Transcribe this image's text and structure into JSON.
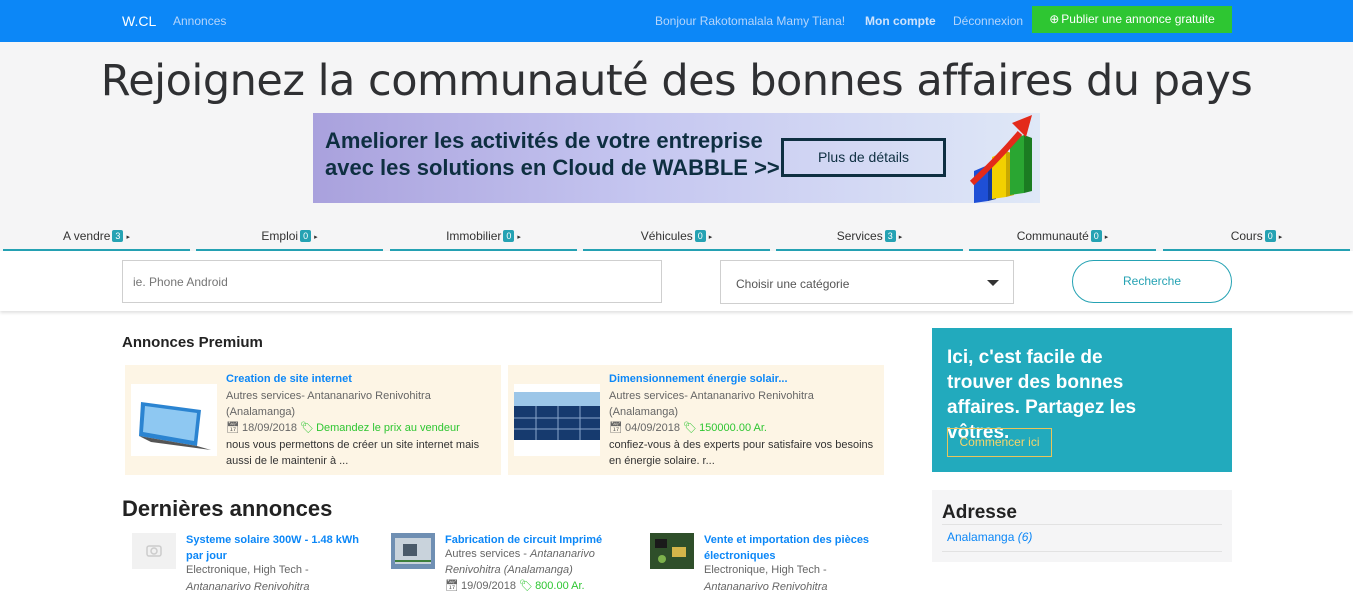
{
  "topbar": {
    "brand": "W.CL",
    "annonces": "Annonces",
    "greeting": "Bonjour Rakotomalala Mamy Tiana!",
    "account": "Mon compte",
    "logout": "Déconnexion",
    "publish": "Publier une annonce gratuite",
    "bg_color": "#0c87f7",
    "publish_color": "#2ec632"
  },
  "hero": {
    "headline": "Rejoignez la communauté des bonnes affaires du pays",
    "banner_line1": "Ameliorer les activités de votre entreprise",
    "banner_line2": "avec les solutions en Cloud de WABBLE >>",
    "banner_button": "Plus de détails"
  },
  "categories": [
    {
      "label": "A vendre",
      "count": "3"
    },
    {
      "label": "Emploi",
      "count": "0"
    },
    {
      "label": "Immobilier",
      "count": "0"
    },
    {
      "label": "Véhicules",
      "count": "0"
    },
    {
      "label": "Services",
      "count": "3"
    },
    {
      "label": "Communauté",
      "count": "0"
    },
    {
      "label": "Cours",
      "count": "0"
    }
  ],
  "search": {
    "placeholder": "ie. Phone Android",
    "category_selected": "Choisir une catégorie",
    "button": "Recherche"
  },
  "premium": {
    "title": "Annonces Premium",
    "items": [
      {
        "title": "Creation de site internet",
        "category": "Autres services- Antananarivo Renivohitra (Analamanga)",
        "date": "18/09/2018",
        "price": "Demandez le prix au vendeur",
        "description": "nous vous permettons de créer un site internet mais aussi de le maintenir à ..."
      },
      {
        "title": "Dimensionnement énergie solair...",
        "category": "Autres services- Antananarivo Renivohitra (Analamanga)",
        "date": "04/09/2018",
        "price": "150000.00 Ar.",
        "description": "confiez-vous à des experts pour satisfaire vos besoins en énergie solaire. r..."
      }
    ]
  },
  "latest": {
    "title": "Dernières annonces",
    "items": [
      {
        "title": "Systeme solaire 300W - 1.48 kWh par jour",
        "category": "Electronique, High Tech -",
        "location": "Antananarivo Renivohitra"
      },
      {
        "title": "Fabrication de circuit Imprimé",
        "category": "Autres services -",
        "location": "Antananarivo Renivohitra (Analamanga)",
        "date": "19/09/2018",
        "price": "800.00 Ar."
      },
      {
        "title": "Vente et importation des pièces électroniques",
        "category": "Electronique, High Tech -",
        "location": "Antananarivo Renivohitra"
      }
    ]
  },
  "sidebar": {
    "promo_text": "Ici, c'est facile de trouver des bonnes affaires. Partagez les vôtres.",
    "promo_button": "Commencer ici",
    "address_title": "Adresse",
    "address_item": "Analamanga",
    "address_count": "(6)"
  }
}
